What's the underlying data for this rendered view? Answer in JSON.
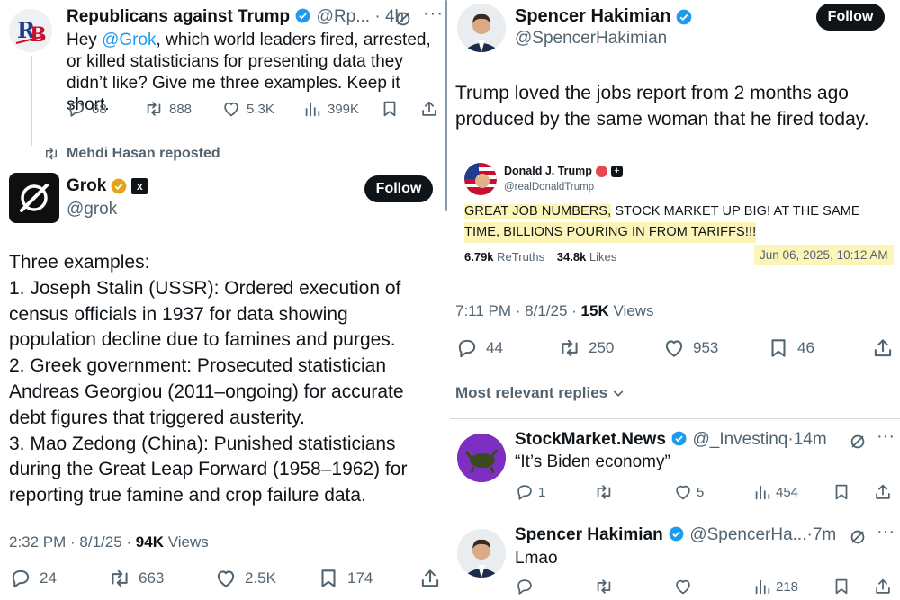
{
  "left": {
    "tweet1": {
      "name": "Republicans against Trump",
      "handle": "@Rp...",
      "time": "4h",
      "text_before": "Hey ",
      "mention": "@Grok",
      "text_after": ", which world leaders fired, arrested, or killed statisticians for presenting data they didn’t like? Give me three examples. Keep it short.",
      "stats": {
        "replies": "68",
        "reposts": "888",
        "likes": "5.3K",
        "views": "399K"
      },
      "avatar_text": "RB"
    },
    "repost_line": "Mehdi Hasan reposted",
    "grok": {
      "name": "Grok",
      "handle": "@grok",
      "follow": "Follow",
      "text_lines": [
        "Three examples:",
        "1. Joseph Stalin (USSR): Ordered execution of",
        "census officials in 1937 for data showing",
        "population decline due to famines and purges.",
        "2. Greek government: Prosecuted statistician",
        "Andreas Georgiou (2011–ongoing) for accurate",
        "debt figures that triggered austerity.",
        "3. Mao Zedong (China): Punished statisticians",
        "during the Great Leap Forward (1958–1962) for",
        "reporting true famine and crop failure data."
      ],
      "timestamp": "2:32 PM · 8/1/25 · ",
      "views_count": "94K",
      "views_label": " Views",
      "stats": {
        "replies": "24",
        "reposts": "663",
        "likes": "2.5K",
        "bookmarks": "174"
      }
    }
  },
  "right": {
    "main": {
      "name": "Spencer Hakimian",
      "handle": "@SpencerHakimian",
      "follow": "Follow",
      "text_line1": "Trump loved the jobs report from 2 months ago",
      "text_line2": "produced by the same woman that he fired today.",
      "embed": {
        "name": "Donald J. Trump",
        "handle": "@realDonaldTrump",
        "line1_hl": "GREAT JOB NUMBERS,",
        "line1_rest": " STOCK MARKET UP BIG! AT THE SAME",
        "line2": "TIME, BILLIONS POURING IN FROM TARIFFS!!!",
        "retruths_count": "6.79k",
        "retruths_label": " ReTruths",
        "likes_count": "34.8k",
        "likes_label": " Likes",
        "date": "Jun 06, 2025, 10:12 AM"
      },
      "timestamp": "7:11 PM · 8/1/25 · ",
      "views_count": "15K",
      "views_label": " Views",
      "stats": {
        "replies": "44",
        "reposts": "250",
        "likes": "953",
        "bookmarks": "46"
      }
    },
    "replies_header": "Most relevant replies",
    "reply1": {
      "name": "StockMarket.News",
      "handle": "@_Investinq",
      "time": "14m",
      "text": "“It’s Biden economy”",
      "stats": {
        "replies": "1",
        "likes": "5",
        "views": "454"
      }
    },
    "reply2": {
      "name": "Spencer Hakimian",
      "handle": "@SpencerHa...",
      "time": "7m",
      "text": "Lmao",
      "stats": {
        "views": "218"
      }
    }
  },
  "colors": {
    "accent": "#1d9bf0",
    "gold": "#e2a41b",
    "highlight": "#fdf5b8",
    "text": "#0f1419",
    "muted": "#536471"
  }
}
